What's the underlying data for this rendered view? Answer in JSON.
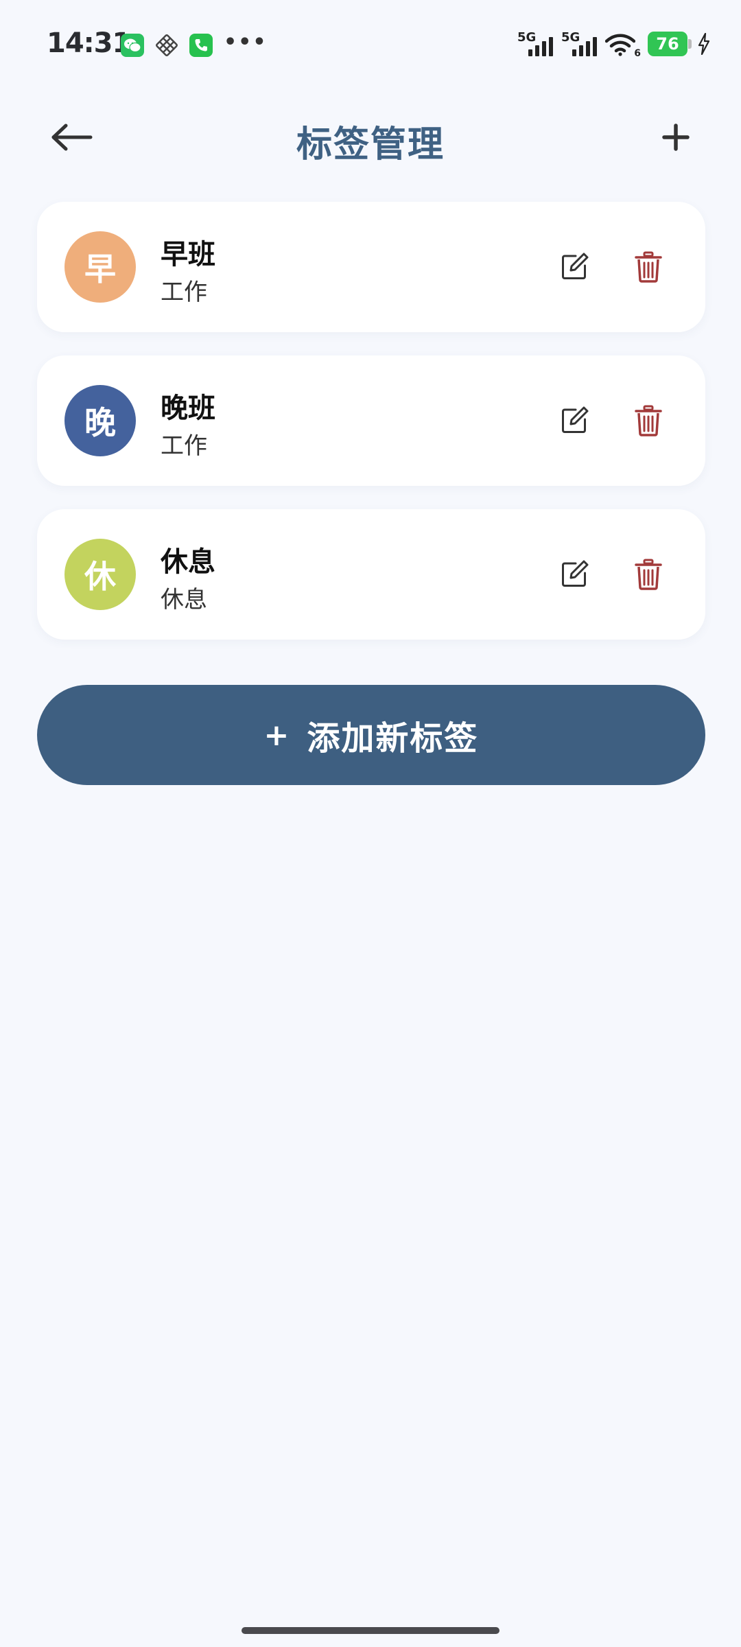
{
  "status_bar": {
    "time": "14:31",
    "left_icons": [
      "wechat-icon",
      "grid-app-icon",
      "phone-icon",
      "more-dots-icon"
    ],
    "more_dots": "•••",
    "signal_1_label": "5G",
    "signal_2_label": "5G",
    "wifi_label": "6",
    "battery_level": "76"
  },
  "header": {
    "title": "标签管理",
    "back_icon": "arrow-left-icon",
    "add_icon": "plus-icon"
  },
  "tags": [
    {
      "initial": "早",
      "name": "早班",
      "category": "工作",
      "color": "#efae7b"
    },
    {
      "initial": "晚",
      "name": "晚班",
      "category": "工作",
      "color": "#44629d"
    },
    {
      "initial": "休",
      "name": "休息",
      "category": "休息",
      "color": "#c3d35e"
    }
  ],
  "add_new_button": {
    "plus": "+",
    "label": "添加新标签"
  },
  "colors": {
    "background": "#f6f8fd",
    "primary": "#3e5f81",
    "title": "#3f6183",
    "delete": "#a23a3a",
    "edit": "#333333"
  }
}
